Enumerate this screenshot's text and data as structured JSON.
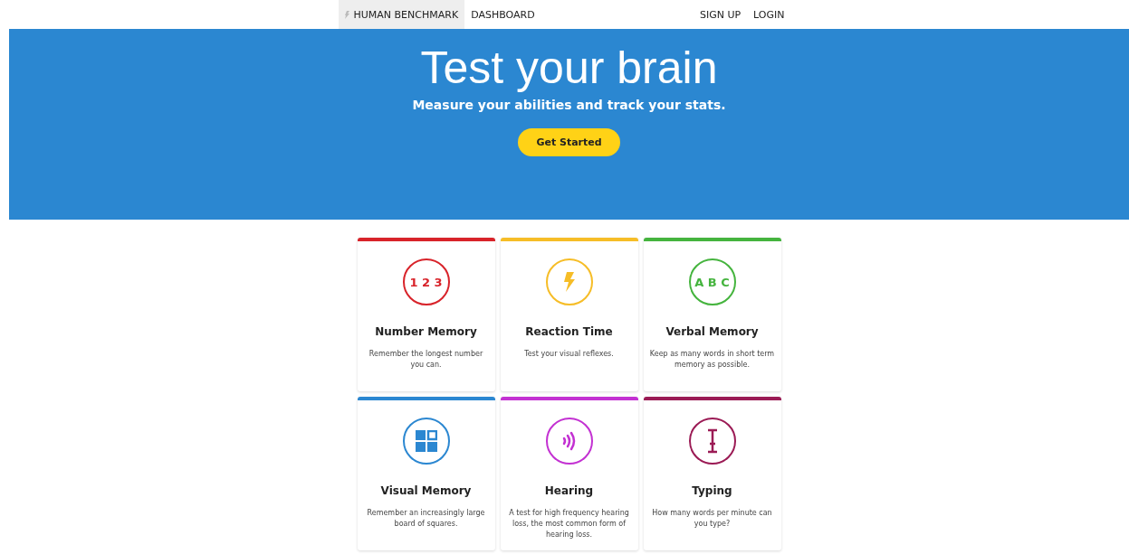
{
  "nav": {
    "left": [
      {
        "label": "HUMAN BENCHMARK",
        "selected": true,
        "kind": "brand"
      },
      {
        "label": "DASHBOARD",
        "selected": false,
        "kind": "link"
      }
    ],
    "right": [
      {
        "label": "SIGN UP",
        "selected": false
      },
      {
        "label": "LOGIN",
        "selected": false
      }
    ]
  },
  "hero": {
    "title": "Test your brain",
    "subtitle": "Measure your abilities and track your stats.",
    "button": "Get Started"
  },
  "cards": [
    {
      "kind": "text",
      "glyph": "1 2 3",
      "title": "Number Memory",
      "description": "Remember the longest number you can.",
      "color": "#d8232a"
    },
    {
      "kind": "bolt",
      "title": "Reaction Time",
      "description": "Test your visual reflexes.",
      "color": "#f6bd27"
    },
    {
      "kind": "text",
      "glyph": "A B C",
      "title": "Verbal Memory",
      "description": "Keep as many words in short term memory as possible.",
      "color": "#45b43e"
    },
    {
      "kind": "grid",
      "title": "Visual Memory",
      "description": "Remember an increasingly large board of squares.",
      "color": "#2b87d1"
    },
    {
      "kind": "sound",
      "title": "Hearing",
      "description": "A test for high frequency hearing loss, the most common form of hearing loss.",
      "color": "#c331d2"
    },
    {
      "kind": "cursor",
      "title": "Typing",
      "description": "How many words per minute can you type?",
      "color": "#9b1b55"
    }
  ]
}
